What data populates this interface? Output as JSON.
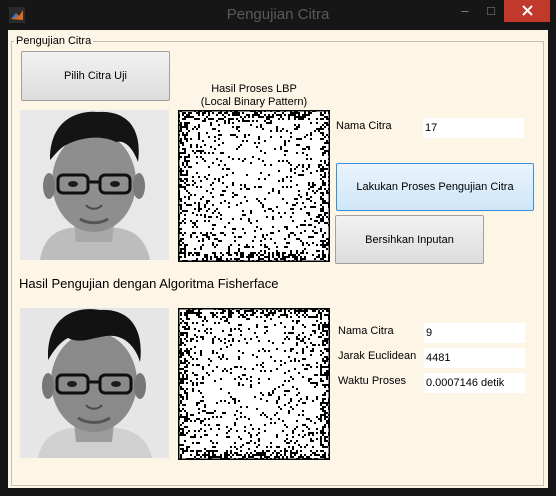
{
  "window": {
    "title": "Pengujian Citra",
    "minimize_glyph": "–",
    "maximize_glyph": "□"
  },
  "panel": {
    "title": "Pengujian Citra"
  },
  "buttons": {
    "pilih_label": "Pilih Citra Uji",
    "proses_label": "Lakukan Proses Pengujian Citra",
    "bersihkan_label": "Bersihkan Inputan"
  },
  "lbp": {
    "caption_line1": "Hasil Proses LBP",
    "caption_line2": "(Local Binary Pattern)"
  },
  "input": {
    "nama_label": "Nama Citra",
    "nama_value": "17"
  },
  "result": {
    "heading": "Hasil Pengujian dengan Algoritma Fisherface",
    "nama_label": "Nama Citra",
    "nama_value": "9",
    "jarak_label": "Jarak Euclidean",
    "jarak_value": "4481",
    "waktu_label": "Waktu Proses",
    "waktu_value": "0.0007146 detik"
  },
  "icons": {
    "app": "matlab-icon",
    "close": "close-icon",
    "photos": "face-photo",
    "lbp_images": "lbp-noise-image"
  },
  "colors": {
    "titlebar": "#161616",
    "close_button": "#c0392b",
    "panel_background": "#fdf5e6",
    "primary_button_border": "#3c8fd6"
  }
}
